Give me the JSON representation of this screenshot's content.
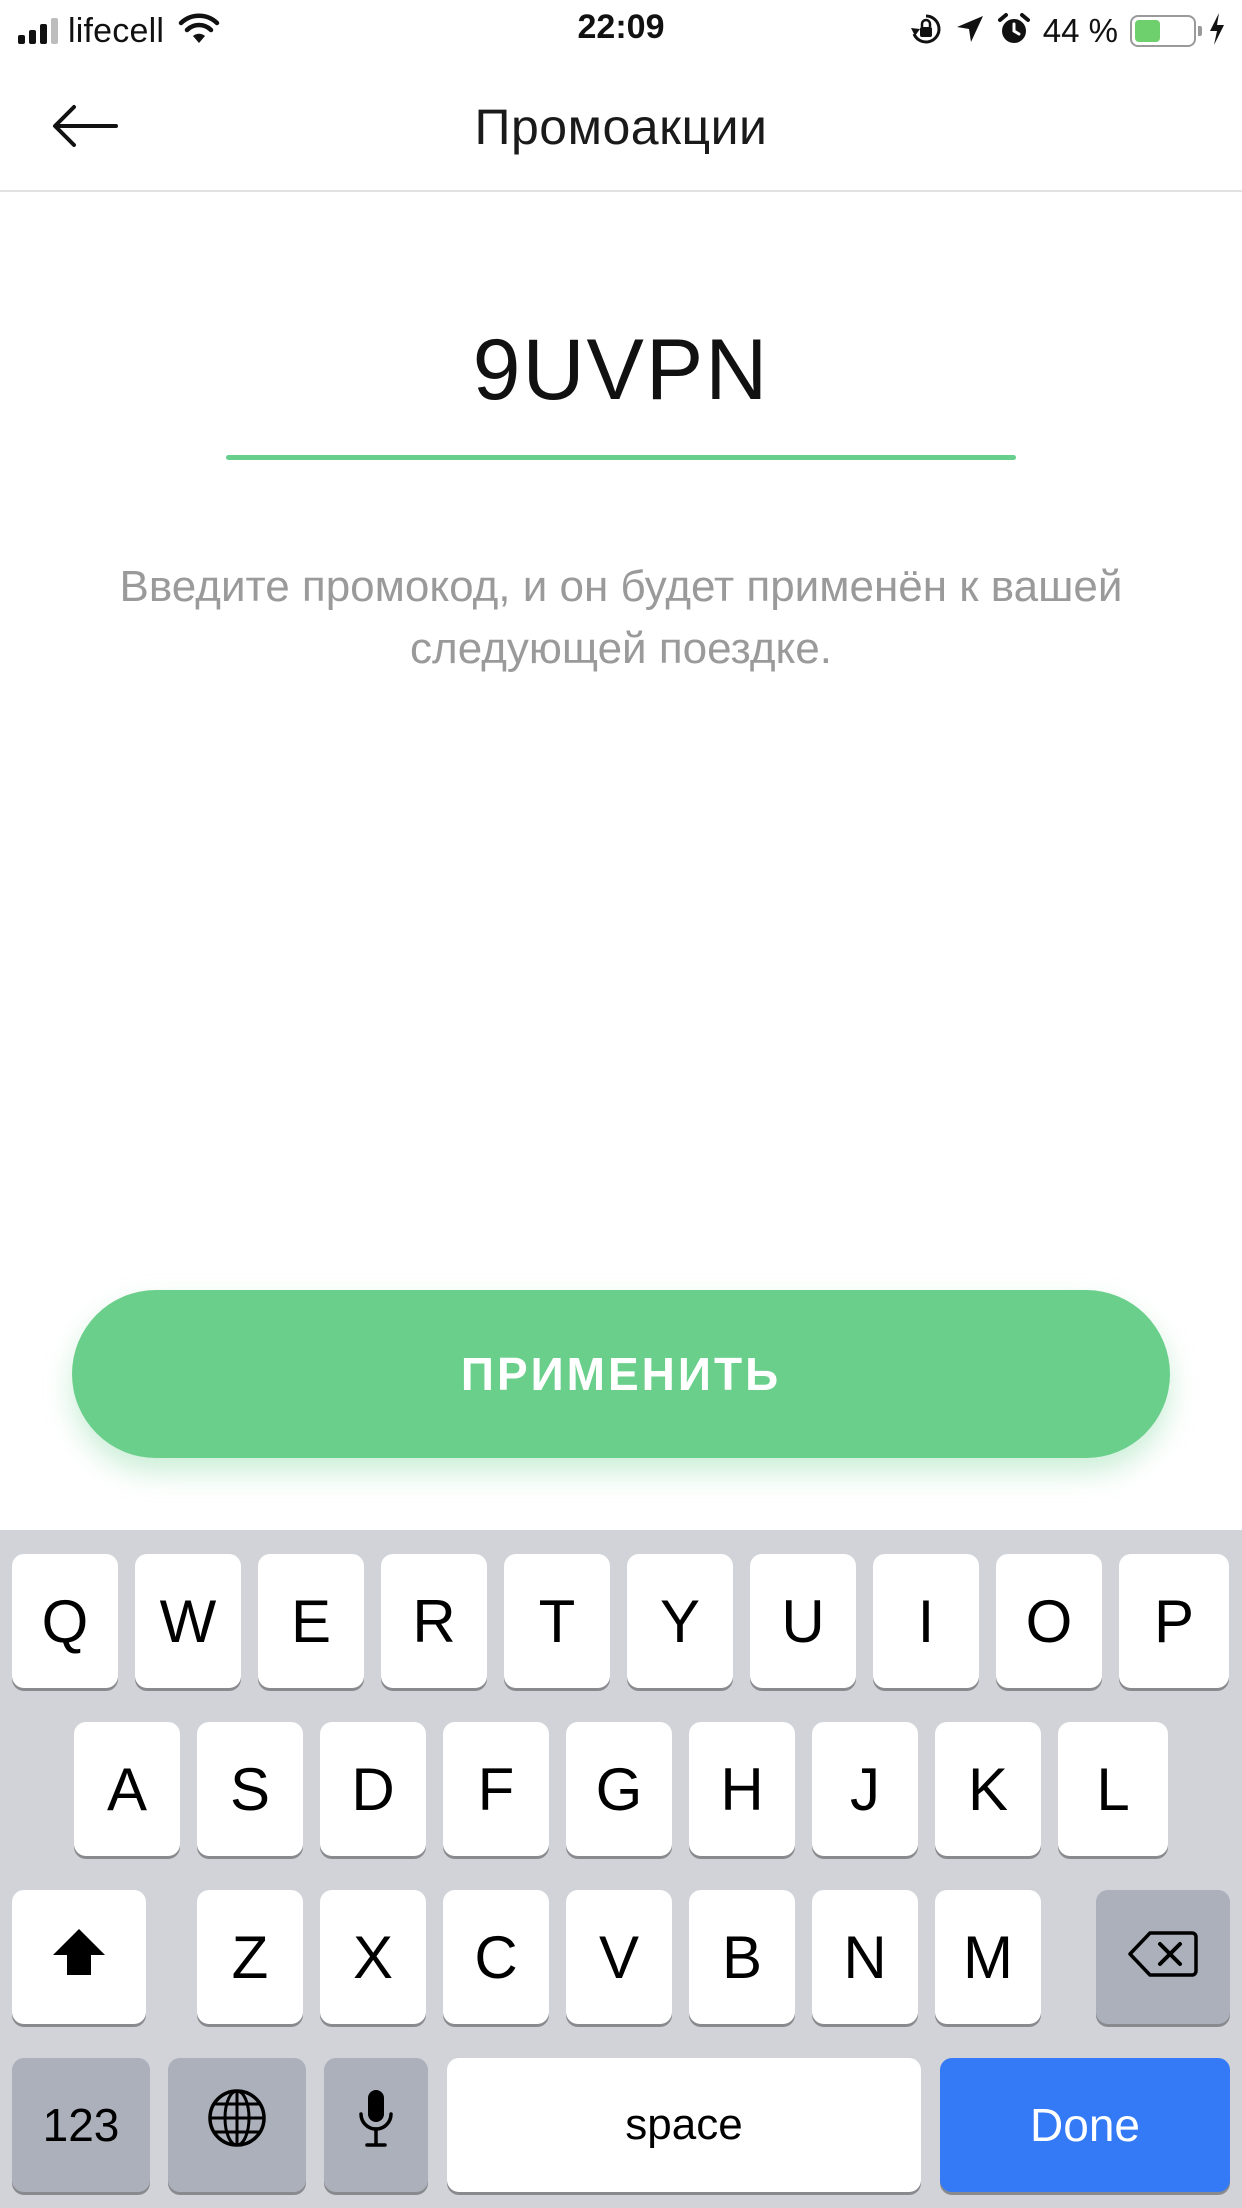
{
  "status_bar": {
    "carrier": "lifecell",
    "time": "22:09",
    "battery_percent": "44 %",
    "battery_level": 0.44,
    "icons": [
      "signal-icon",
      "wifi-icon",
      "orientation-lock-icon",
      "location-arrow-icon",
      "alarm-icon",
      "battery-icon",
      "charging-bolt-icon"
    ]
  },
  "nav": {
    "title": "Промоакции",
    "back_icon": "arrow-left-icon"
  },
  "promo": {
    "code_value": "9UVPN",
    "hint": "Введите промокод, и он будет применён к вашей следующей поездке.",
    "underline_color": "#67cf8c"
  },
  "apply_button": {
    "label": "ПРИМЕНИТЬ",
    "color": "#6acf8b"
  },
  "keyboard": {
    "row1": [
      "Q",
      "W",
      "E",
      "R",
      "T",
      "Y",
      "U",
      "I",
      "O",
      "P"
    ],
    "row2": [
      "A",
      "S",
      "D",
      "F",
      "G",
      "H",
      "J",
      "K",
      "L"
    ],
    "row3": [
      "Z",
      "X",
      "C",
      "V",
      "B",
      "N",
      "M"
    ],
    "numbers_label": "123",
    "space_label": "space",
    "done_label": "Done",
    "done_color": "#347af6"
  }
}
